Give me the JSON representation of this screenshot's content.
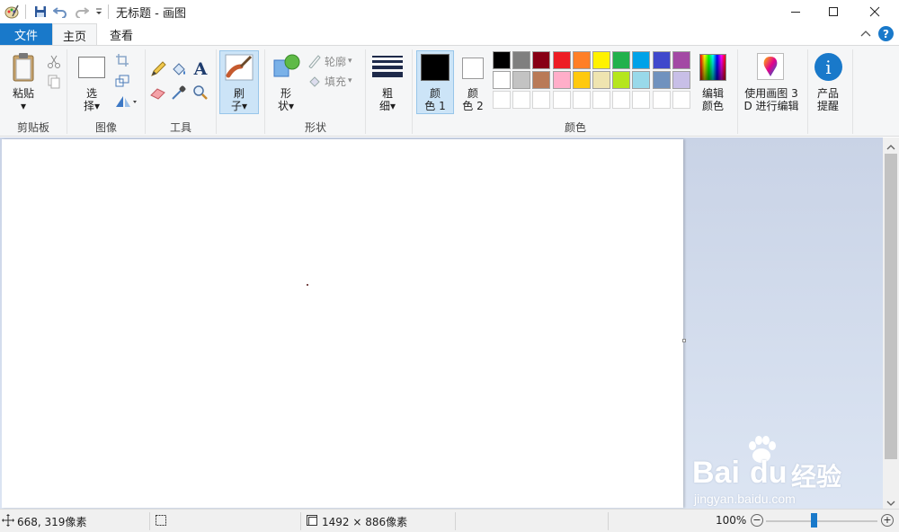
{
  "title": "无标题 - 画图",
  "tabs": {
    "file": "文件",
    "home": "主页",
    "view": "查看"
  },
  "ribbon": {
    "clipboard": {
      "paste_label_line1": "粘贴",
      "group_label": "剪贴板"
    },
    "image": {
      "select_line1": "选",
      "select_line2": "择",
      "group_label": "图像"
    },
    "tools": {
      "group_label": "工具"
    },
    "brush": {
      "label_line1": "刷",
      "label_line2": "子"
    },
    "shapes": {
      "label_line1": "形",
      "label_line2": "状",
      "outline": "轮廓",
      "fill": "填充",
      "group_label": "形状"
    },
    "size": {
      "label_line1": "粗",
      "label_line2": "细"
    },
    "colors": {
      "color1_line1": "颜",
      "color1_line2": "色 1",
      "color2_line1": "颜",
      "color2_line2": "色 2",
      "edit_line1": "编辑",
      "edit_line2": "颜色",
      "group_label": "颜色",
      "palette_row1": [
        "#000000",
        "#7f7f7f",
        "#880015",
        "#ed1c24",
        "#ff7f27",
        "#fff200",
        "#22b14c",
        "#00a2e8",
        "#3f48cc",
        "#a349a4"
      ],
      "palette_row2": [
        "#ffffff",
        "#c3c3c3",
        "#b97a57",
        "#ffaec9",
        "#ffc90e",
        "#efe4b0",
        "#b5e61d",
        "#99d9ea",
        "#7092be",
        "#c8bfe7"
      ]
    },
    "paint3d": {
      "line1": "使用画图 3",
      "line2": "D 进行编辑"
    },
    "product": {
      "line1": "产品",
      "line2": "提醒"
    }
  },
  "status": {
    "cursor_pos": "668, 319像素",
    "image_size": "1492 × 886像素",
    "zoom": "100%"
  },
  "watermark": {
    "brand": "Bai",
    "brand2": "du",
    "cn": "经验",
    "url": "jingyan.baidu.com"
  }
}
